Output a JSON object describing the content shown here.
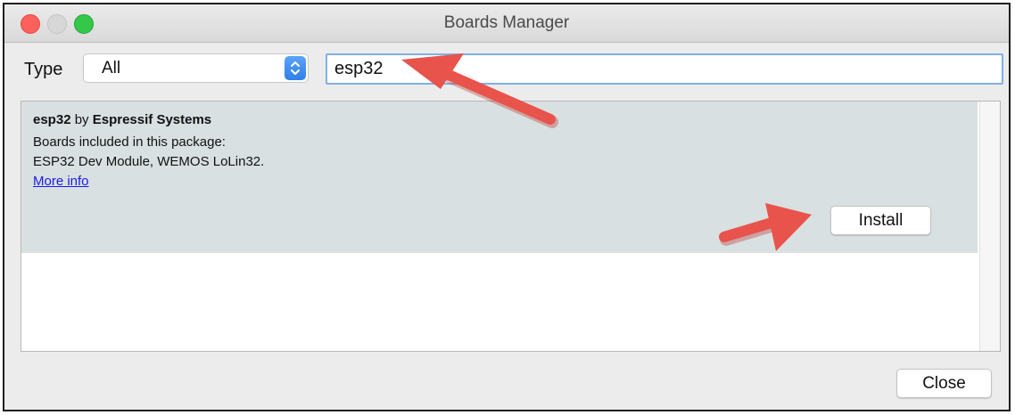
{
  "window": {
    "title": "Boards Manager"
  },
  "filter": {
    "type_label": "Type",
    "type_value": "All",
    "search_value": "esp32"
  },
  "results": [
    {
      "name": "esp32",
      "by": "by",
      "author": "Espressif Systems",
      "line1": "Boards included in this package:",
      "line2": "ESP32 Dev Module, WEMOS LoLin32.",
      "more_info": "More info",
      "install_label": "Install"
    }
  ],
  "footer": {
    "close_label": "Close"
  },
  "colors": {
    "annotation_arrow": "#e8534b",
    "selected_item_bg": "#d9e0e1",
    "link": "#1a1ae6"
  }
}
